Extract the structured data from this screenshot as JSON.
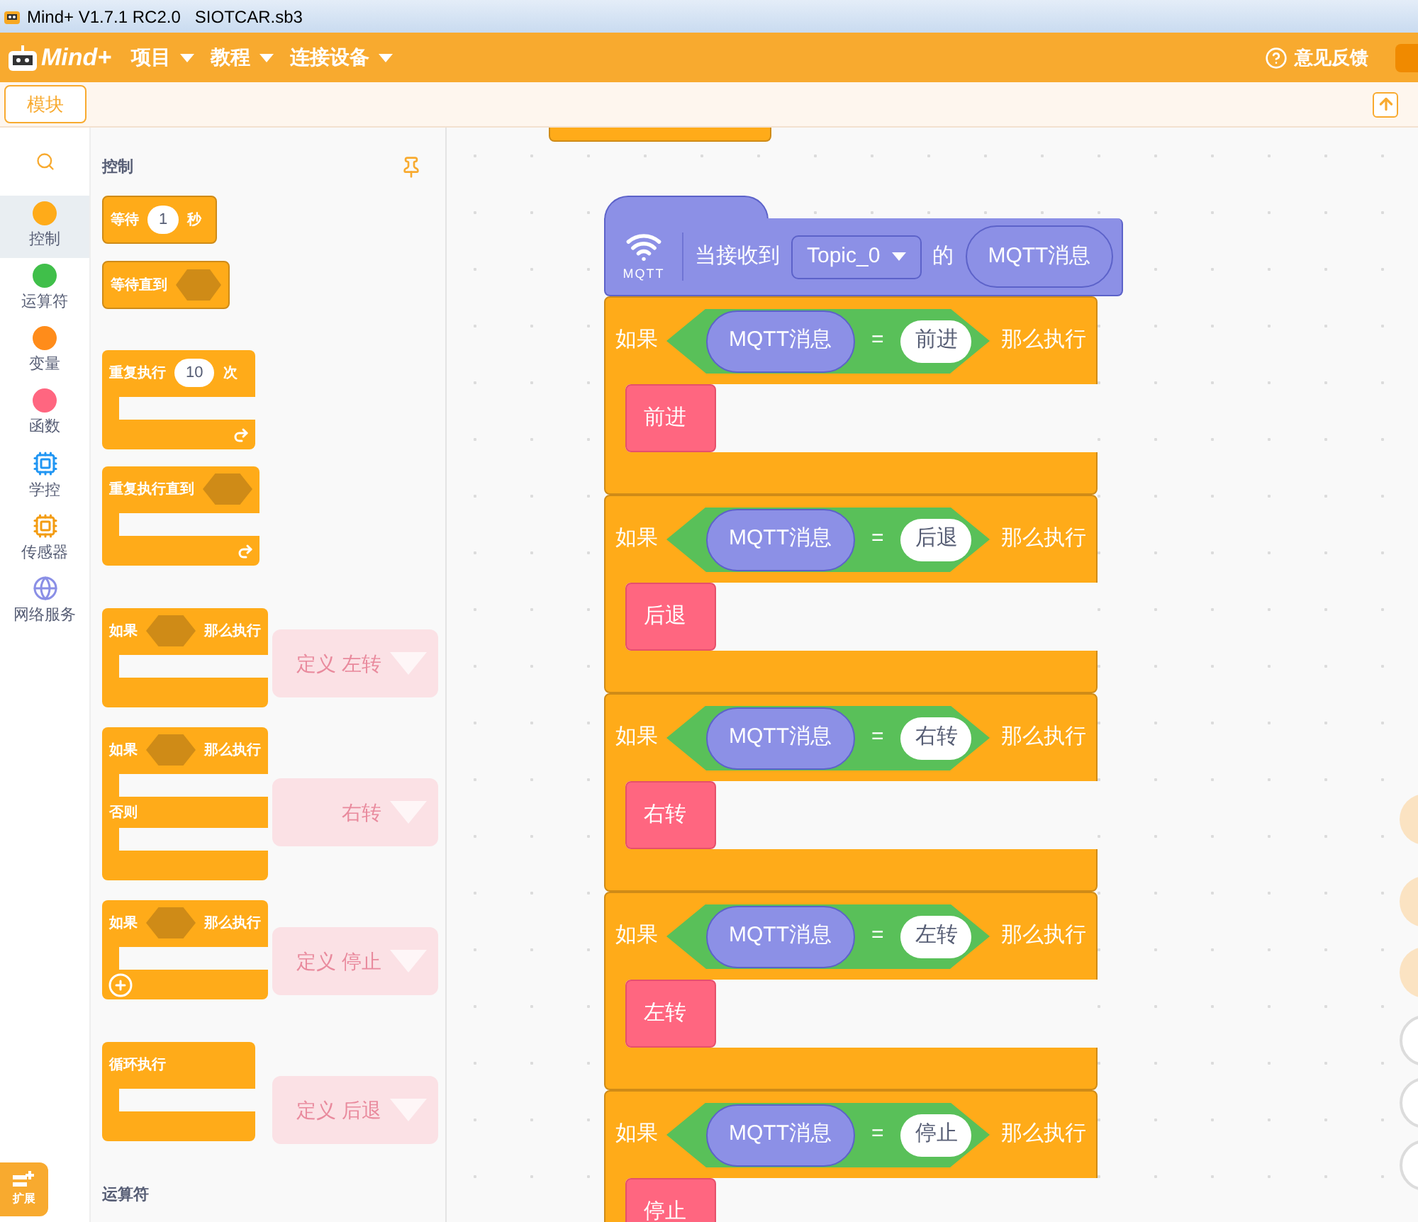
{
  "window": {
    "title": "Mind+ V1.7.1 RC2.0   SIOTCAR.sb3"
  },
  "menu_bar": {
    "logo": "Mind+",
    "menus": [
      {
        "label": "项目"
      },
      {
        "label": "教程"
      },
      {
        "label": "连接设备"
      }
    ],
    "feedback": "意见反馈"
  },
  "tabs": [
    {
      "label": "模块",
      "selected": true
    }
  ],
  "categories": [
    {
      "label": "控制",
      "kind": "dot",
      "color": "#ffab19",
      "selected": true
    },
    {
      "label": "运算符",
      "kind": "dot",
      "color": "#40bf4a",
      "selected": false
    },
    {
      "label": "变量",
      "kind": "dot",
      "color": "#ff8c1a",
      "selected": false
    },
    {
      "label": "函数",
      "kind": "dot",
      "color": "#ff6680",
      "selected": false
    },
    {
      "label": "学控",
      "kind": "chip",
      "selected": false
    },
    {
      "label": "传感器",
      "kind": "sensor",
      "selected": false
    },
    {
      "label": "网络服务",
      "kind": "globe",
      "selected": false
    }
  ],
  "extension": {
    "label": "扩展"
  },
  "palette": {
    "section": "控制",
    "blocks": [
      {
        "kind": "wait",
        "label": "等待",
        "input": "1",
        "suffix": "秒"
      },
      {
        "kind": "wait_until",
        "label": "等待直到"
      },
      {
        "kind": "repeat",
        "label": "重复执行",
        "input": "10",
        "suffix": "次"
      },
      {
        "kind": "repeat_until",
        "label": "重复执行直到"
      },
      {
        "kind": "if",
        "label": "如果",
        "then": "那么执行"
      },
      {
        "kind": "if_else",
        "label": "如果",
        "then": "那么执行",
        "else": "否则"
      },
      {
        "kind": "if_plus",
        "label": "如果",
        "then": "那么执行"
      },
      {
        "kind": "forever",
        "label": "循环执行"
      }
    ],
    "next_section": "运算符"
  },
  "ghost_blocks": [
    "定义 左转",
    "右转",
    "定义 停止",
    "定义 后退"
  ],
  "script": {
    "hat": {
      "icon_label": "MQTT",
      "label": "当接收到",
      "topic": "Topic_0",
      "of": "的",
      "reporter": "MQTT消息"
    },
    "if_blocks": [
      {
        "if": "如果",
        "reporter": "MQTT消息",
        "op": "=",
        "value": "前进",
        "then": "那么执行",
        "action": "前进"
      },
      {
        "if": "如果",
        "reporter": "MQTT消息",
        "op": "=",
        "value": "后退",
        "then": "那么执行",
        "action": "后退"
      },
      {
        "if": "如果",
        "reporter": "MQTT消息",
        "op": "=",
        "value": "右转",
        "then": "那么执行",
        "action": "右转"
      },
      {
        "if": "如果",
        "reporter": "MQTT消息",
        "op": "=",
        "value": "左转",
        "then": "那么执行",
        "action": "左转"
      },
      {
        "if": "如果",
        "reporter": "MQTT消息",
        "op": "=",
        "value": "停止",
        "then": "那么执行",
        "action": "停止"
      }
    ]
  }
}
